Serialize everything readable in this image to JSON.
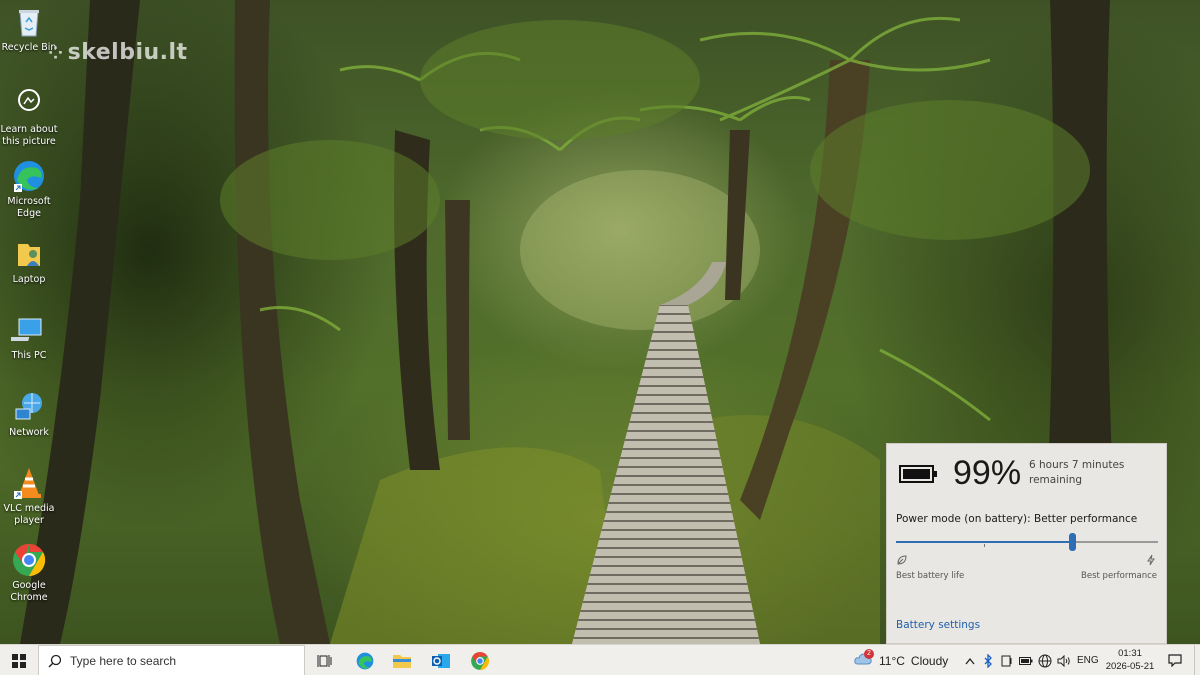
{
  "watermark": {
    "text": "skelbiu.lt"
  },
  "desktop": {
    "icons": [
      {
        "name": "recycle-bin",
        "label": "Recycle Bin"
      },
      {
        "name": "learn-about-picture",
        "label": "Learn about this picture"
      },
      {
        "name": "microsoft-edge",
        "label": "Microsoft Edge"
      },
      {
        "name": "laptop-folder",
        "label": "Laptop"
      },
      {
        "name": "this-pc",
        "label": "This PC"
      },
      {
        "name": "network",
        "label": "Network"
      },
      {
        "name": "vlc-media-player",
        "label": "VLC media player"
      },
      {
        "name": "google-chrome",
        "label": "Google Chrome"
      }
    ]
  },
  "battery": {
    "percent": "99%",
    "remaining": "6 hours 7 minutes remaining",
    "power_mode": "Power mode (on battery): Better performance",
    "slider_level": 0.67,
    "best_life_label": "Best battery life",
    "best_perf_label": "Best performance",
    "settings_link": "Battery settings"
  },
  "taskbar": {
    "search_placeholder": "Type here to search",
    "apps": [
      "task-view-icon",
      "edge-icon",
      "file-explorer-icon",
      "outlook-icon",
      "chrome-icon"
    ],
    "weather": {
      "temp": "11°C",
      "condition": "Cloudy",
      "badge": "2"
    },
    "language": "ENG",
    "time": "01:31",
    "date": "2026-05-21"
  },
  "colors": {
    "accent": "#2f6db5",
    "link": "#1f5fa8",
    "taskbar": "#f1efec",
    "flyout": "#e9e7e3"
  }
}
